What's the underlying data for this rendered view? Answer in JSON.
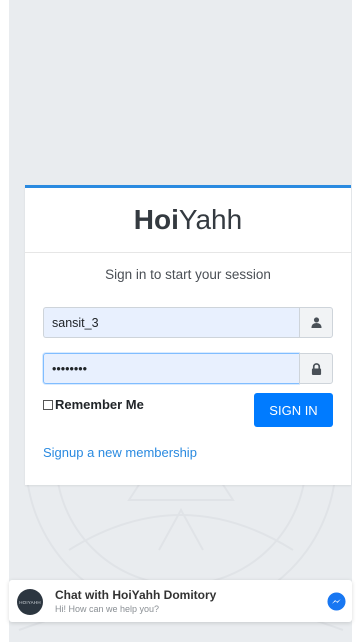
{
  "brand": {
    "bold": "Hoi",
    "light": "Yahh"
  },
  "login": {
    "subtitle": "Sign in to start your session",
    "username_value": "sansit_3",
    "password_value": "••••••••",
    "remember_label": "Remember Me",
    "signin_label": "SIGN IN",
    "signup_link": "Signup a new membership"
  },
  "icons": {
    "username": "user-icon",
    "password": "lock-icon",
    "chat": "messenger-icon"
  },
  "chat": {
    "title": "Chat with HoiYahh Domitory",
    "subtitle": "Hi! How can we help you?",
    "avatar_text": "HOIYAHH"
  },
  "colors": {
    "accent": "#2a8ae0",
    "button": "#007bff",
    "background": "#e9ecef"
  }
}
